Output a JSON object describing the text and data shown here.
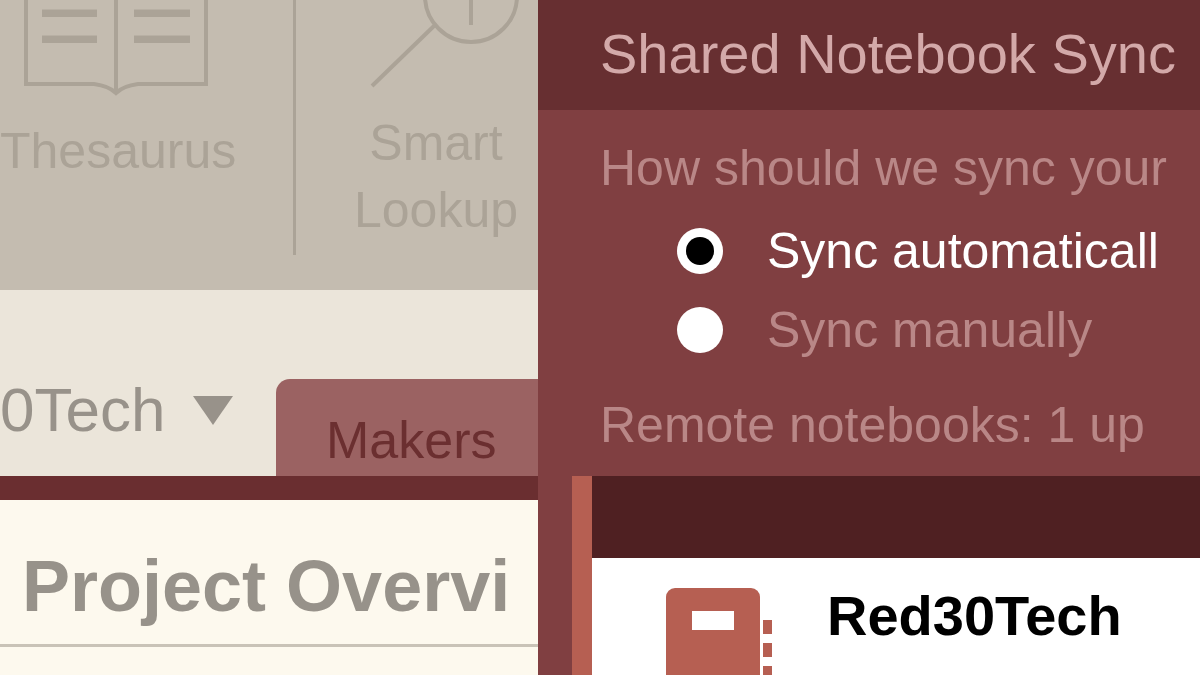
{
  "ribbon": {
    "buttons": [
      {
        "kind": "thesaurus",
        "label": "Thesaurus"
      },
      {
        "kind": "lookup",
        "label": "Smart Lookup"
      }
    ]
  },
  "notebook_bar": {
    "notebook": "0Tech",
    "section_tabs": [
      {
        "label": "Makers"
      }
    ]
  },
  "page": {
    "title": "Project Overvi"
  },
  "dialog": {
    "title": "Shared Notebook Sync",
    "question": "How should we sync your",
    "options": [
      {
        "label": "Sync automaticall",
        "selected": true
      },
      {
        "label": "Sync manually",
        "selected": false
      }
    ],
    "status": "Remote notebooks: 1 up"
  },
  "notebook_pane": {
    "notebooks": [
      {
        "name": "Red30Tech",
        "color": "#b65f52"
      }
    ]
  }
}
